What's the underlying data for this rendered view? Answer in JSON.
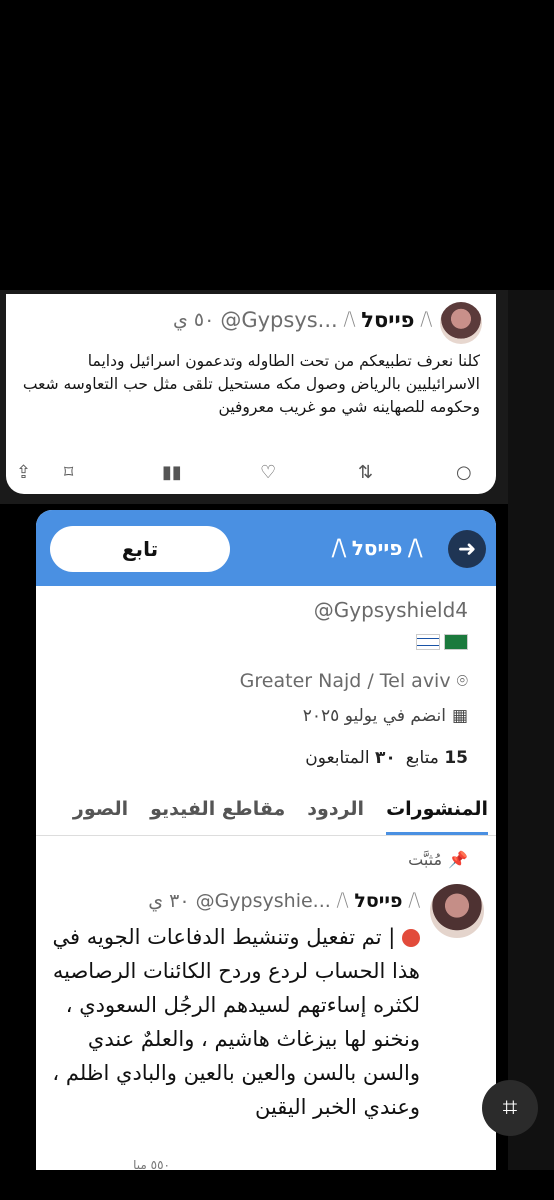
{
  "tweet": {
    "name": "פייסל",
    "handle": "@Gypsys...",
    "time": "٥٠ ي",
    "text": "كلنا نعرف تطبيعكم من تحت الطاوله وتدعمون اسرائيل ودايما الاسرائيليين بالرياض وصول مكه مستحيل تلقى مثل حب التعاوسه شعب وحكومه للصهاينه شي مو غريب معروفين",
    "icons": [
      "share-icon",
      "bookmark-icon",
      "views-icon",
      "like-icon",
      "retweet-icon",
      "reply-icon"
    ]
  },
  "profile": {
    "follow_label": "تابع",
    "banner_name": "פייסל",
    "handle": "@Gypsyshield4",
    "location": "Greater Najd / Tel aviv",
    "joined": "انضم في يوليو ٢٠٢٥",
    "following_count": "15",
    "following_label": "متابع",
    "followers_count": "٣٠",
    "followers_label": "المتابعون",
    "tabs": [
      "المنشورات",
      "الردود",
      "مقاطع الفيديو",
      "الصور"
    ]
  },
  "pinned_tweet": {
    "pinned_label": "مُثبَّت",
    "name": "פייסל",
    "handle": "@Gypsyshie...",
    "time": "٣٠ ي",
    "text": "| تم تفعيل وتنشيط الدفاعات الجويه في هذا الحساب لردع وردح الكائنات الرصاصيه لكثره إساءتهم لسيدهم الرجُل السعودي ، ونخنو لها بيزغاث هاشيم ، والعلمٌ عندي والسن بالسن والعين بالعين والبادي اظلم ، وعندي الخبر اليقين",
    "views": "٥٥٠ ميا"
  },
  "colors": {
    "accent": "#4a90e2",
    "red_dot": "#e24b3b"
  }
}
